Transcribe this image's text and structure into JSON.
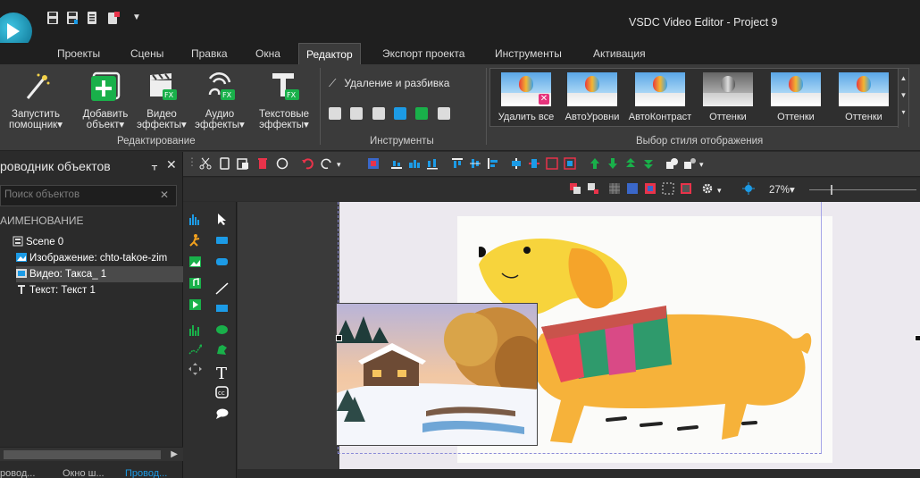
{
  "window": {
    "title": "VSDC Video Editor - Project 9"
  },
  "quick_access": [
    "save-icon",
    "save-as-icon",
    "document-icon",
    "export-icon",
    "customize-arrow-icon"
  ],
  "menu_tabs": [
    {
      "label": "Проекты",
      "active": false
    },
    {
      "label": "Сцены",
      "active": false
    },
    {
      "label": "Правка",
      "active": false
    },
    {
      "label": "Окна",
      "active": false
    },
    {
      "label": "Редактор",
      "active": true
    },
    {
      "label": "Экспорт проекта",
      "active": false
    },
    {
      "label": "Инструменты",
      "active": false
    },
    {
      "label": "Активация",
      "active": false
    }
  ],
  "ribbon": {
    "editing": {
      "group_label": "Редактирование",
      "buttons": [
        {
          "line1": "Запустить",
          "line2": "помощник▾",
          "icon": "wizard-wand-icon"
        },
        {
          "line1": "Добавить",
          "line2": "объект▾",
          "icon": "add-object-icon"
        },
        {
          "line1": "Видео",
          "line2": "эффекты▾",
          "icon": "video-effects-icon"
        },
        {
          "line1": "Аудио",
          "line2": "эффекты▾",
          "icon": "audio-effects-icon"
        },
        {
          "line1": "Текстовые",
          "line2": "эффекты▾",
          "icon": "text-effects-icon"
        }
      ]
    },
    "tools": {
      "group_label": "Инструменты",
      "split_label": "Удаление и разбивка"
    },
    "styles": {
      "group_label": "Выбор стиля отображения",
      "items": [
        {
          "label": "Удалить все",
          "gray": false,
          "badge": "✕"
        },
        {
          "label": "АвтоУровни",
          "gray": false
        },
        {
          "label": "АвтоКонтраст",
          "gray": false
        },
        {
          "label": "Оттенки",
          "gray": true
        },
        {
          "label": "Оттенки",
          "gray": false
        },
        {
          "label": "Оттенки",
          "gray": false
        }
      ]
    }
  },
  "object_explorer": {
    "title": "роводник объектов",
    "pin": "ᚁ",
    "close": "✕",
    "search_placeholder": "Поиск объектов",
    "search_clear": "✕",
    "column_header": "АИМЕНОВАНИЕ",
    "tree": [
      {
        "label": "Scene 0",
        "icon": "scene-icon",
        "selected": false
      },
      {
        "label": "Изображение: chto-takoe-zim",
        "icon": "image-icon",
        "selected": false
      },
      {
        "label": "Видео: Такса_ 1",
        "icon": "video-icon",
        "selected": true
      },
      {
        "label": "Текст: Текст 1",
        "icon": "text-icon",
        "selected": false
      }
    ],
    "bottom_tabs": [
      "ровод...",
      "Окно ш...",
      "Провод..."
    ]
  },
  "editor": {
    "zoom": "27%▾"
  },
  "colors": {
    "accent_green": "#19b04a",
    "accent_blue": "#1c9be6",
    "accent_red": "#e8334a",
    "ribbon_bg": "#3b3b3b",
    "title_bg": "#1f1f1f"
  }
}
